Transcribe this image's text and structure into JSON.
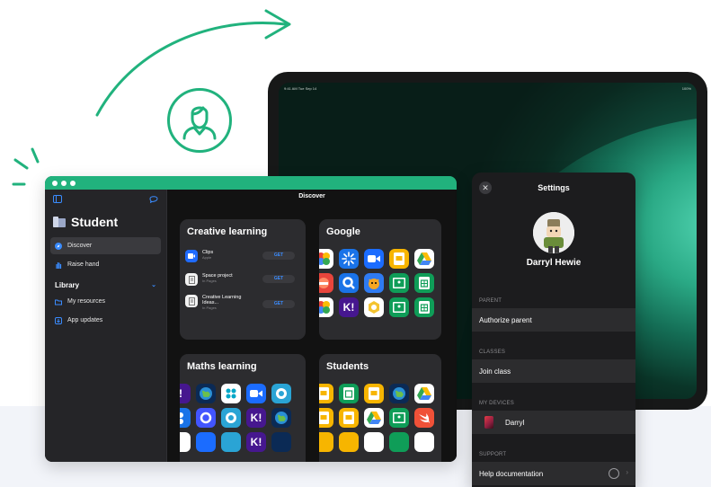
{
  "colors": {
    "accent": "#21b27d",
    "link": "#3a8cff",
    "dark_bg": "#1d1d1f",
    "card": "#2c2c2f"
  },
  "ipad": {
    "status_time": "9:41 AM   Tue Sep 14",
    "status_battery": "100%"
  },
  "mac_app": {
    "sidebar": {
      "title": "Student",
      "items": [
        {
          "label": "Discover",
          "icon": "compass-icon",
          "selected": true
        },
        {
          "label": "Raise hand",
          "icon": "hand-icon"
        }
      ],
      "library": {
        "label": "Library",
        "items": [
          {
            "label": "My resources",
            "icon": "folder-icon"
          },
          {
            "label": "App updates",
            "icon": "download-icon"
          }
        ]
      }
    },
    "content_title": "Discover",
    "cards": {
      "creative": {
        "title": "Creative learning",
        "rows": [
          {
            "title": "Clips",
            "subtitle": "Apple",
            "button": "GET"
          },
          {
            "title": "Space project",
            "subtitle": "In Pages",
            "button": "GET"
          },
          {
            "title": "Creative Learning Ideas...",
            "subtitle": "In Pages",
            "button": "GET"
          }
        ]
      },
      "google": {
        "title": "Google"
      },
      "maths": {
        "title": "Maths learning"
      },
      "students": {
        "title": "Students"
      }
    }
  },
  "settings": {
    "close_icon": "close-icon",
    "title": "Settings",
    "user_name": "Darryl Hewie",
    "sections": {
      "parent": {
        "label": "PARENT",
        "row": "Authorize parent"
      },
      "classes": {
        "label": "CLASSES",
        "row": "Join class"
      },
      "devices": {
        "label": "MY DEVICES",
        "row": "Darryl"
      },
      "support": {
        "label": "SUPPORT",
        "row": "Help documentation"
      }
    }
  }
}
